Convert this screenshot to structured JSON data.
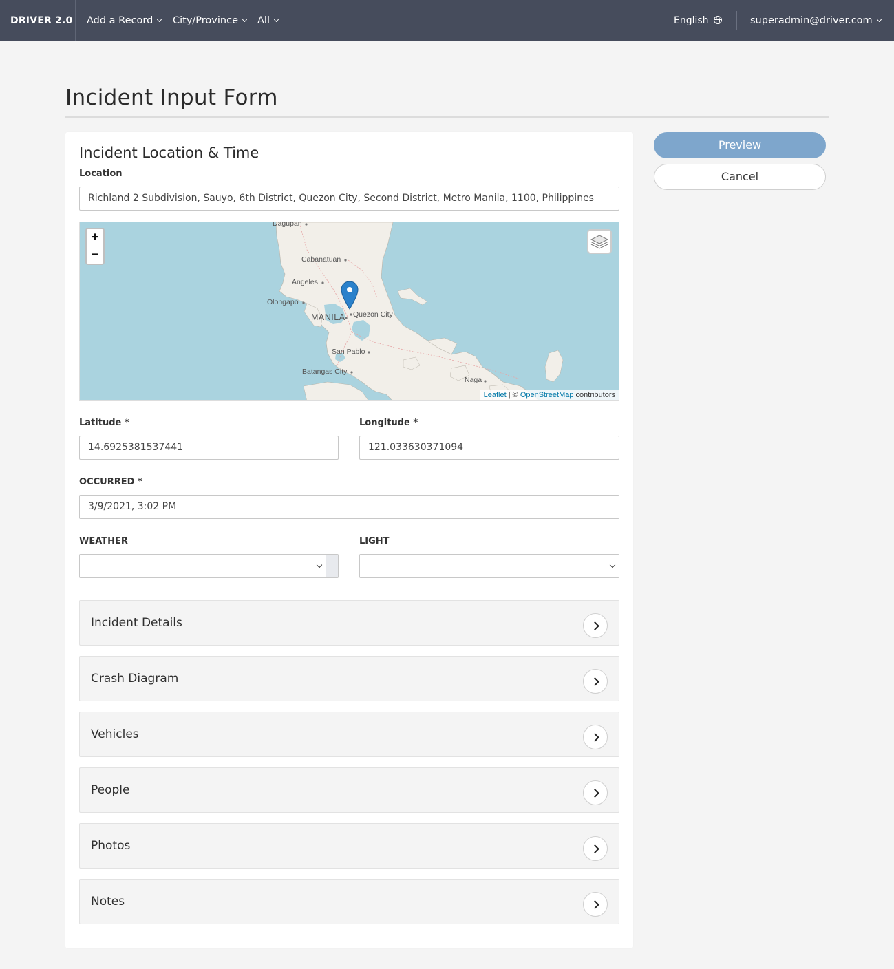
{
  "navbar": {
    "brand": "DRIVER 2.0",
    "menus": [
      {
        "label": "Add a Record"
      },
      {
        "label": "City/Province"
      },
      {
        "label": "All"
      }
    ],
    "language": "English",
    "user": "superadmin@driver.com"
  },
  "page": {
    "title": "Incident Input Form"
  },
  "form": {
    "section_title": "Incident Location & Time",
    "location": {
      "label": "Location",
      "value": "Richland 2 Subdivision, Sauyo, 6th District, Quezon City, Second District, Metro Manila, 1100, Philippines"
    },
    "map": {
      "zoom_in": "+",
      "zoom_out": "−",
      "places": [
        "Dagupan",
        "Cabanatuan",
        "Angeles",
        "Olongapo",
        "MANILA",
        "Quezon City",
        "San Pablo",
        "Batangas City",
        "Naga"
      ],
      "attribution_leaflet": "Leaflet",
      "attribution_sep": " | © ",
      "attribution_osm": "OpenStreetMap",
      "attribution_suffix": " contributors"
    },
    "latitude": {
      "label": "Latitude *",
      "value": "14.6925381537441"
    },
    "longitude": {
      "label": "Longitude *",
      "value": "121.033630371094"
    },
    "occurred": {
      "label": "OCCURRED *",
      "value": "3/9/2021, 3:02 PM"
    },
    "weather": {
      "label": "WEATHER",
      "value": ""
    },
    "light": {
      "label": "LIGHT",
      "value": ""
    }
  },
  "sections": [
    {
      "title": "Incident Details"
    },
    {
      "title": "Crash Diagram"
    },
    {
      "title": "Vehicles"
    },
    {
      "title": "People"
    },
    {
      "title": "Photos"
    },
    {
      "title": "Notes"
    }
  ],
  "actions": {
    "preview": "Preview",
    "cancel": "Cancel"
  },
  "colors": {
    "navbar": "#464c5c",
    "preview_button": "#7ea6cc",
    "marker": "#2a81cb"
  }
}
